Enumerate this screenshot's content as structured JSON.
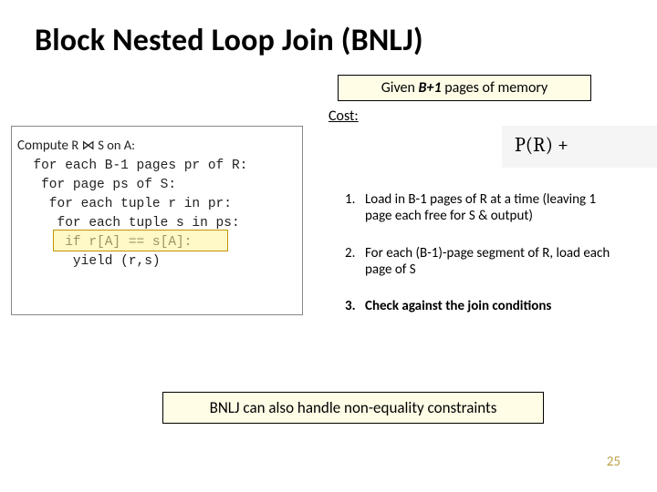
{
  "title": "Block Nested Loop Join (BNLJ)",
  "given": {
    "prefix": "Given ",
    "em": "B+1",
    "suffix": " pages of memory"
  },
  "cost_label": "Cost:",
  "formula": "P(R) + ",
  "code": {
    "l0a": "Compute ",
    "l0b": "R ⋈ S on A:",
    "l1": "  for each B-1 pages pr of R:",
    "l2": "   for page ps of S:",
    "l3": "    for each tuple r in pr:",
    "l4": "     for each tuple s in ps:",
    "l5": "      if r[A] == s[A]:",
    "l6": "       yield (r,s)"
  },
  "steps": [
    {
      "num": "1.",
      "txt": "Load in B-1 pages of R at a time (leaving 1 page each free for S & output)"
    },
    {
      "num": "2.",
      "txt": "For each (B-1)-page segment of R, load each page of S"
    },
    {
      "num": "3.",
      "txt": "Check against the join conditions"
    }
  ],
  "footer": "BNLJ can also handle non-equality constraints",
  "page_number": "25"
}
